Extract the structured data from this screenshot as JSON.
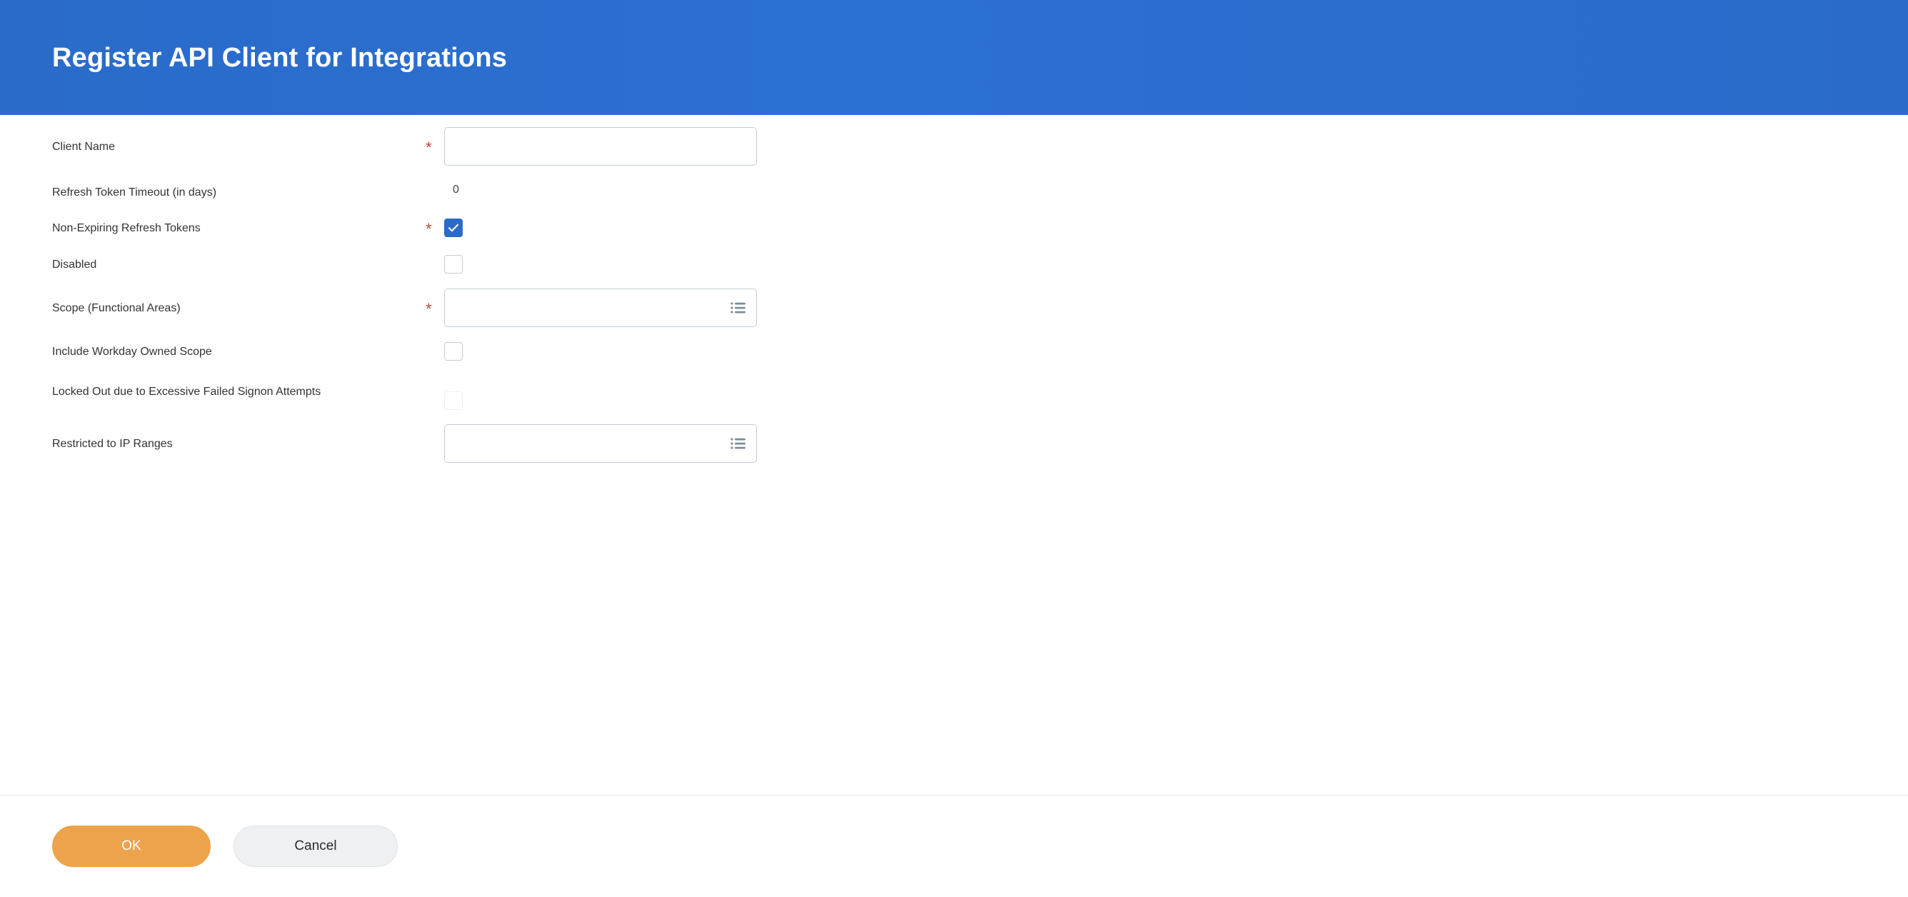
{
  "header": {
    "title": "Register API Client for Integrations",
    "background_color": "#2c70d2",
    "text_color": "#ffffff"
  },
  "colors": {
    "accent_blue": "#2a6bc9",
    "required_red": "#d93a32",
    "ok_orange": "#eda34c",
    "cancel_gray": "#eef0f1",
    "field_border": "#c3ccd3",
    "label_text": "#333333",
    "prompt_icon": "#7e8c99"
  },
  "form": {
    "rows": [
      {
        "label": "Client Name",
        "required": true,
        "control": "text",
        "value": "",
        "placeholder": "",
        "icon": null
      },
      {
        "label": "Refresh Token Timeout (in days)",
        "required": false,
        "control": "readonly",
        "value": "0",
        "icon": null
      },
      {
        "label": "Non-Expiring Refresh Tokens",
        "required": true,
        "control": "checkbox",
        "checked": true,
        "disabled": false,
        "icon": "check-icon"
      },
      {
        "label": "Disabled",
        "required": false,
        "control": "checkbox",
        "checked": false,
        "disabled": false,
        "icon": null
      },
      {
        "label": "Scope (Functional Areas)",
        "required": true,
        "control": "prompt",
        "value": "",
        "placeholder": "",
        "icon": "list-prompt-icon"
      },
      {
        "label": "Include Workday Owned Scope",
        "required": false,
        "control": "checkbox",
        "checked": false,
        "disabled": false,
        "icon": null
      },
      {
        "label": "Locked Out due to Excessive Failed Signon Attempts",
        "required": false,
        "control": "checkbox",
        "checked": false,
        "disabled": true,
        "icon": null
      },
      {
        "label": "Restricted to IP Ranges",
        "required": false,
        "control": "prompt",
        "value": "",
        "placeholder": "",
        "icon": "list-prompt-icon"
      }
    ],
    "required_marker": "*"
  },
  "footer": {
    "ok_label": "OK",
    "cancel_label": "Cancel"
  }
}
